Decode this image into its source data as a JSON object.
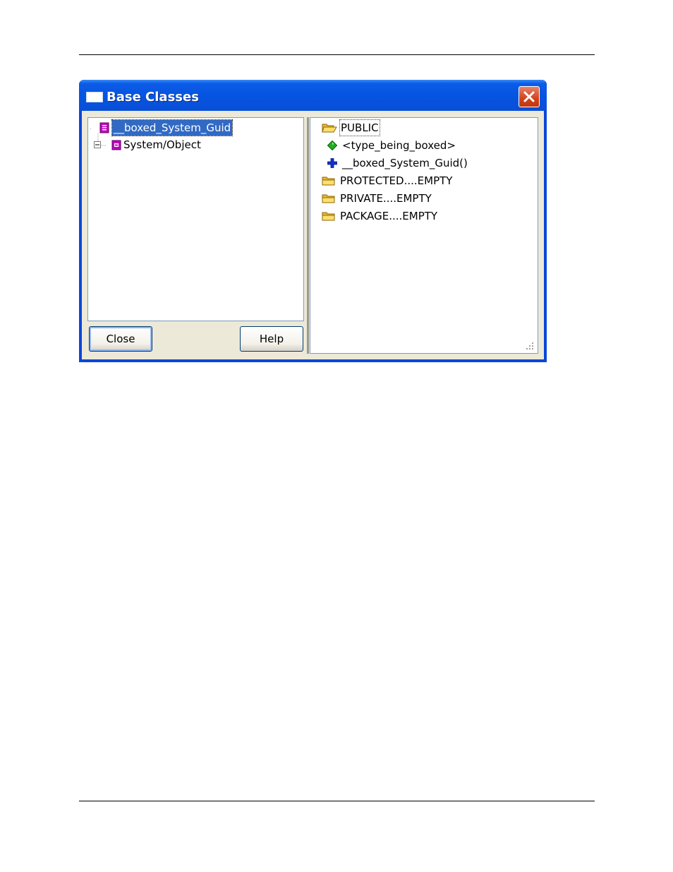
{
  "dialog": {
    "title": "Base Classes"
  },
  "class_tree": {
    "items": [
      {
        "label": "__boxed_System_Guid",
        "icon": "class-icon",
        "selected": true
      },
      {
        "label": "System/Object",
        "icon": "class-icon",
        "expander": "minus"
      }
    ]
  },
  "members_tree": {
    "items": [
      {
        "label": "PUBLIC",
        "icon": "folder-open-icon"
      },
      {
        "label": "<type_being_boxed>",
        "icon": "green-diamond-icon"
      },
      {
        "label": "__boxed_System_Guid()",
        "icon": "blue-plus-icon"
      },
      {
        "label": "PROTECTED....EMPTY",
        "icon": "folder-icon"
      },
      {
        "label": "PRIVATE....EMPTY",
        "icon": "folder-icon"
      },
      {
        "label": "PACKAGE....EMPTY",
        "icon": "folder-icon"
      }
    ]
  },
  "buttons": {
    "close_label": "Close",
    "help_label": "Help"
  },
  "colors": {
    "titlebar": "#0554e0",
    "selection": "#316ac5",
    "dialog_face": "#ece9d8",
    "close_button": "#d2431d"
  }
}
